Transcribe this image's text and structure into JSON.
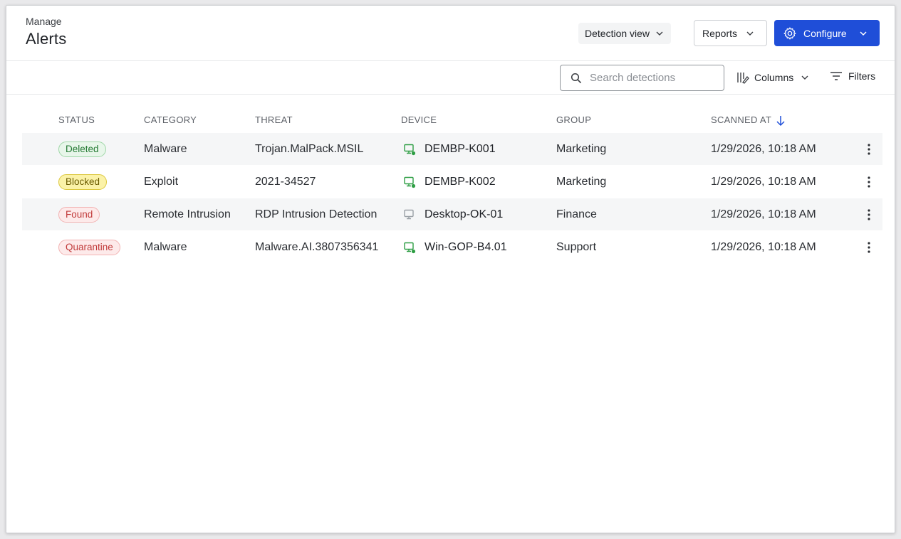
{
  "header": {
    "breadcrumb": "Manage",
    "title": "Alerts",
    "detection_view_label": "Detection view",
    "reports_label": "Reports",
    "configure_label": "Configure"
  },
  "toolbar": {
    "search_placeholder": "Search detections",
    "columns_label": "Columns",
    "filters_label": "Filters"
  },
  "table": {
    "columns": [
      "STATUS",
      "CATEGORY",
      "THREAT",
      "DEVICE",
      "GROUP",
      "SCANNED AT"
    ],
    "sort_column": "SCANNED AT",
    "sort_direction": "descending",
    "rows": [
      {
        "status": "Deleted",
        "status_type": "deleted",
        "category": "Malware",
        "threat": "Trojan.MalPack.MSIL",
        "device": "DEMBP-K001",
        "device_online": true,
        "group": "Marketing",
        "scanned_at": "1/29/2026, 10:18 AM"
      },
      {
        "status": "Blocked",
        "status_type": "blocked",
        "category": "Exploit",
        "threat": "2021-34527",
        "device": "DEMBP-K002",
        "device_online": true,
        "group": "Marketing",
        "scanned_at": "1/29/2026, 10:18 AM"
      },
      {
        "status": "Found",
        "status_type": "found",
        "category": "Remote Intrusion",
        "threat": "RDP Intrusion Detection",
        "device": "Desktop-OK-01",
        "device_online": false,
        "group": "Finance",
        "scanned_at": "1/29/2026, 10:18 AM"
      },
      {
        "status": "Quarantine",
        "status_type": "quarantine",
        "category": "Malware",
        "threat": "Malware.AI.3807356341",
        "device": "Win-GOP-B4.01",
        "device_online": true,
        "group": "Support",
        "scanned_at": "1/29/2026, 10:18 AM"
      }
    ]
  },
  "colors": {
    "primary": "#1f4ed8",
    "online": "#2e9e44",
    "offline": "#9aa0a6"
  },
  "icons": {
    "configure": "gear-icon",
    "search": "search-icon",
    "columns": "columns-icon",
    "filters": "filter-lines-icon",
    "sort": "arrow-down-icon",
    "device": "monitor-icon",
    "row_actions": "kebab-icon"
  }
}
